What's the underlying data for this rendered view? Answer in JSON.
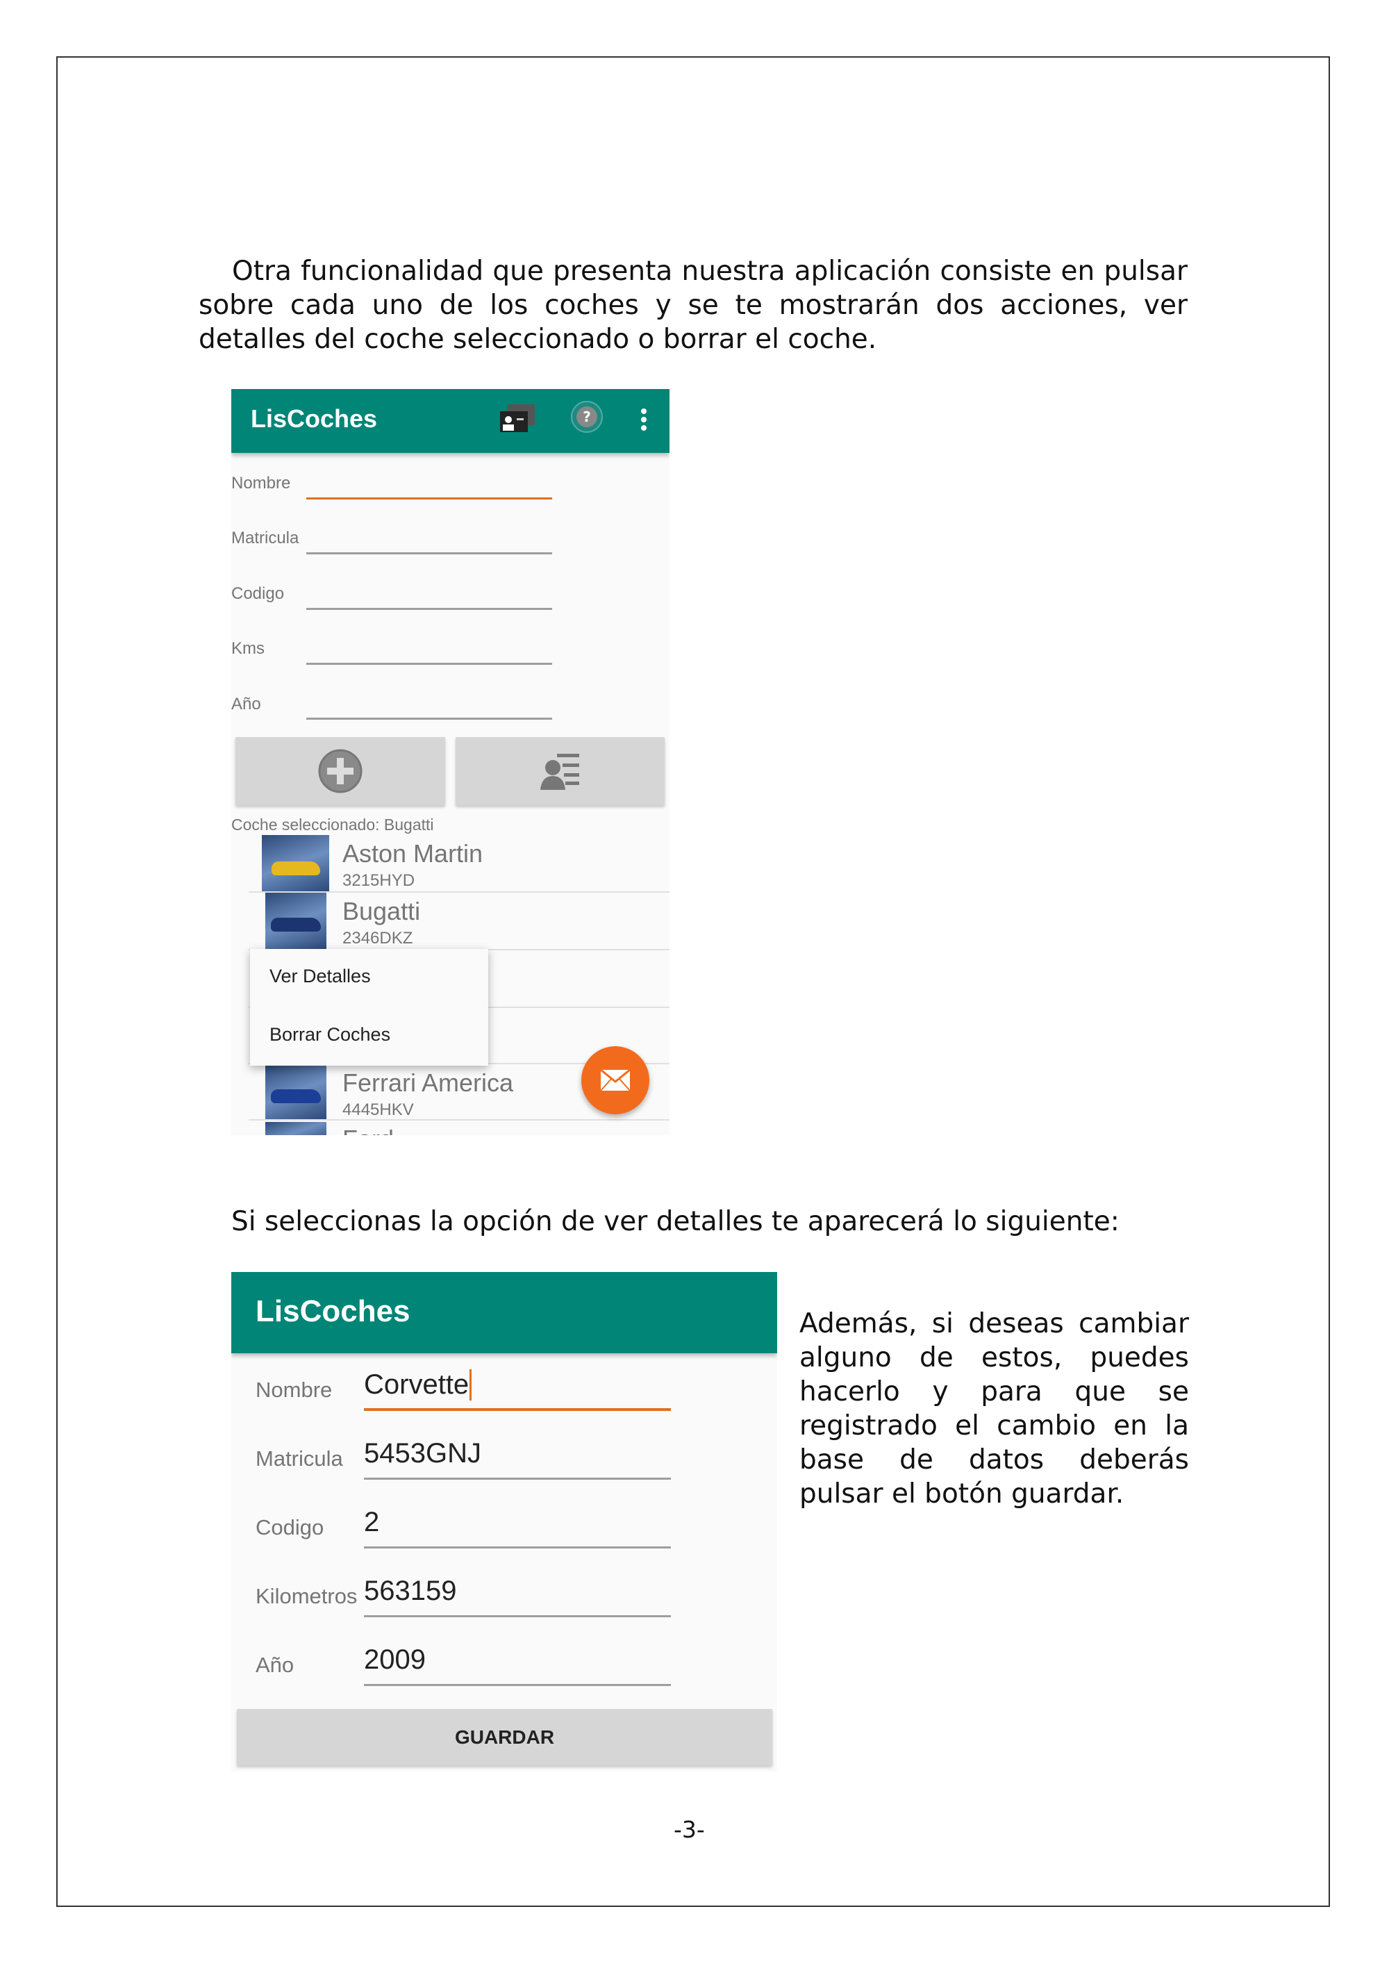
{
  "intro_paragraph": "Otra funcionalidad que presenta nuestra aplicación consiste en pulsar sobre cada uno de los coches y se te mostrarán dos acciones, ver detalles del coche seleccionado o borrar el coche.",
  "screen1": {
    "title": "LisCoches",
    "icons": [
      "contact-card-icon",
      "help-icon",
      "more-vert-icon"
    ],
    "fields": [
      {
        "label": "Nombre",
        "value": ""
      },
      {
        "label": "Matricula",
        "value": ""
      },
      {
        "label": "Codigo",
        "value": ""
      },
      {
        "label": "Kms",
        "value": ""
      },
      {
        "label": "Año",
        "value": ""
      }
    ],
    "selected_text": "Coche seleccionado: Bugatti",
    "cars": [
      {
        "name": "Aston Martin",
        "plate": "3215HYD"
      },
      {
        "name": "Bugatti",
        "plate": "2346DKZ"
      },
      {
        "name": "",
        "plate": ""
      },
      {
        "name": "",
        "plate": ""
      },
      {
        "name": "Ferrari America",
        "plate": "4445HKV"
      },
      {
        "name": "Ford",
        "plate": ""
      }
    ],
    "context_menu": [
      "Ver Detalles",
      "Borrar Coches"
    ],
    "accent": "#008577",
    "fab_color": "#f26b1d"
  },
  "middle_paragraph": "Si seleccionas la opción de ver detalles te aparecerá lo siguiente:",
  "screen2": {
    "title": "LisCoches",
    "fields": [
      {
        "label": "Nombre",
        "value": "Corvette"
      },
      {
        "label": "Matricula",
        "value": "5453GNJ"
      },
      {
        "label": "Codigo",
        "value": "2"
      },
      {
        "label": "Kilometros",
        "value": "563159"
      },
      {
        "label": "Año",
        "value": "2009"
      }
    ],
    "save_label": "GUARDAR"
  },
  "side_paragraph": "Además, si deseas cambiar alguno de estos, puedes hacerlo y para que se registrado el cambio en la base de datos deberás pulsar el botón guardar.",
  "page_number": "-3-"
}
